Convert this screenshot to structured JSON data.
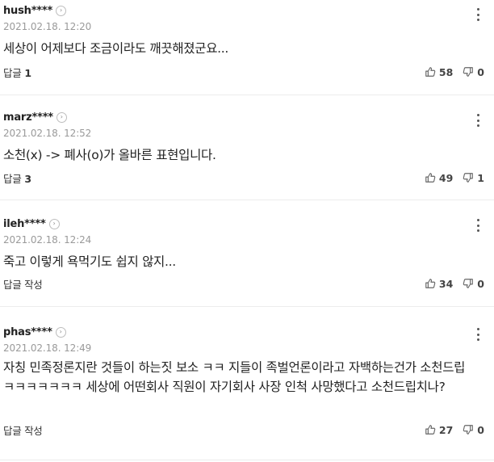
{
  "comments": [
    {
      "author": "hush****",
      "date": "2021.02.18. 12:20",
      "text": "세상이 어제보다 조금이라도 깨끗해졌군요...",
      "reply_label": "답글",
      "reply_count": "1",
      "likes": "58",
      "dislikes": "0"
    },
    {
      "author": "marz****",
      "date": "2021.02.18. 12:52",
      "text": "소천(x) -> 폐사(o)가 올바른 표현입니다.",
      "reply_label": "답글",
      "reply_count": "3",
      "likes": "49",
      "dislikes": "1"
    },
    {
      "author": "ileh****",
      "date": "2021.02.18. 12:24",
      "text": "죽고 이렇게 욕먹기도 쉽지 않지...",
      "reply_label": "답글 작성",
      "likes": "34",
      "dislikes": "0"
    },
    {
      "author": "phas****",
      "date": "2021.02.18. 12:49",
      "text": "자칭 민족정론지란 것들이 하는짓 보소 ㅋㅋ 지들이 족벌언론이라고 자백하는건가 소천드립 ㅋㅋㅋㅋㅋㅋㅋ 세상에 어떤회사 직원이 자기회사 사장 인척 사망했다고 소천드립치나?",
      "reply_label": "답글 작성",
      "likes": "27",
      "dislikes": "0"
    }
  ],
  "icons": {
    "profile": "chevron-right-icon",
    "more": "more-vertical-icon",
    "like": "thumbs-up-icon",
    "dislike": "thumbs-down-icon"
  }
}
